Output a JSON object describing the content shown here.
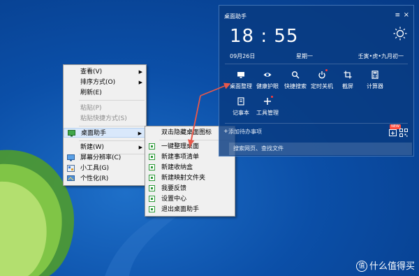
{
  "desktop": {
    "accent": "#0b4fa8"
  },
  "context_menu": {
    "items": [
      {
        "label": "查看(V)",
        "has_submenu": true
      },
      {
        "label": "排序方式(O)",
        "has_submenu": true
      },
      {
        "label": "刷新(E)",
        "has_submenu": false
      },
      {
        "label": "粘贴(P)",
        "disabled": true
      },
      {
        "label": "粘贴快捷方式(S)",
        "disabled": true
      },
      {
        "label": "桌面助手",
        "has_submenu": true,
        "highlighted": true
      },
      {
        "label": "新建(W)",
        "has_submenu": true
      },
      {
        "label": "屏幕分辨率(C)"
      },
      {
        "label": "小工具(G)"
      },
      {
        "label": "个性化(R)"
      }
    ]
  },
  "submenu": {
    "items": [
      "双击隐藏桌面图标",
      "一键整理桌面",
      "新建事项清单",
      "新建收纳盒",
      "新建映射文件夹",
      "我要反馈",
      "设置中心",
      "退出桌面助手"
    ]
  },
  "widget": {
    "title": "桌面助手",
    "time": "18 : 55",
    "date": "09月26日",
    "weekday": "星期一",
    "lunar": "壬寅•虎•九月初一",
    "tools": [
      {
        "label": "桌面整理",
        "icon": "monitor-icon"
      },
      {
        "label": "健康护眼",
        "icon": "eye-icon"
      },
      {
        "label": "快捷搜索",
        "icon": "search-icon"
      },
      {
        "label": "定时关机",
        "icon": "power-icon"
      },
      {
        "label": "截屏",
        "icon": "crop-icon"
      },
      {
        "label": "计算器",
        "icon": "calculator-icon"
      },
      {
        "label": "记事本",
        "icon": "notepad-icon"
      },
      {
        "label": "工具管理",
        "icon": "plus-icon"
      }
    ],
    "todo_placeholder": "添加待办事项",
    "new_badge": "NEW",
    "search_placeholder": "搜索网页、查找文件"
  },
  "watermark": {
    "icon_text": "值",
    "text": "什么值得买"
  }
}
